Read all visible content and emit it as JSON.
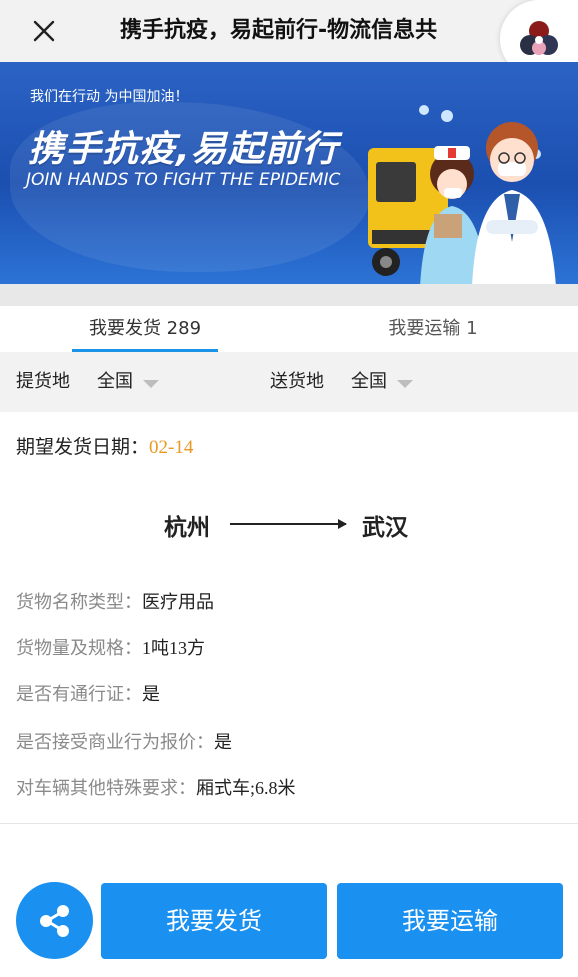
{
  "header": {
    "title": "携手抗疫，易起前行-物流信息共",
    "close_icon": "close-icon",
    "logo_icon": "app-logo-icon"
  },
  "banner": {
    "small_slogan": "我们在行动 为中国加油！",
    "big_slogan": "携手抗疫,易起前行",
    "en_slogan": "JOIN HANDS TO FIGHT THE EPIDEMIC",
    "colors": {
      "background": "#1b4fb0"
    }
  },
  "tabs": [
    {
      "label": "我要发货 289",
      "active": true
    },
    {
      "label": "我要运输 1",
      "active": false
    }
  ],
  "filters": {
    "pickup_label": "提货地",
    "pickup_value": "全国",
    "delivery_label": "送货地",
    "delivery_value": "全国"
  },
  "card": {
    "date_label": "期望发货日期：",
    "date_value": "02-14",
    "route_from": "杭州",
    "route_to": "武汉",
    "rows": [
      {
        "label": "货物名称类型：",
        "value": "医疗用品"
      },
      {
        "label": "货物量及规格：",
        "value": "1吨13方"
      },
      {
        "label": "是否有通行证：",
        "value": "是"
      },
      {
        "label": "是否接受商业行为报价：",
        "value": "是"
      },
      {
        "label": "对车辆其他特殊要求：",
        "value": "厢式车;6.8米"
      }
    ]
  },
  "actions": {
    "share_icon": "share-icon",
    "ship_label": "我要发货",
    "transport_label": "我要运输",
    "accent_color": "#1a90f0"
  }
}
